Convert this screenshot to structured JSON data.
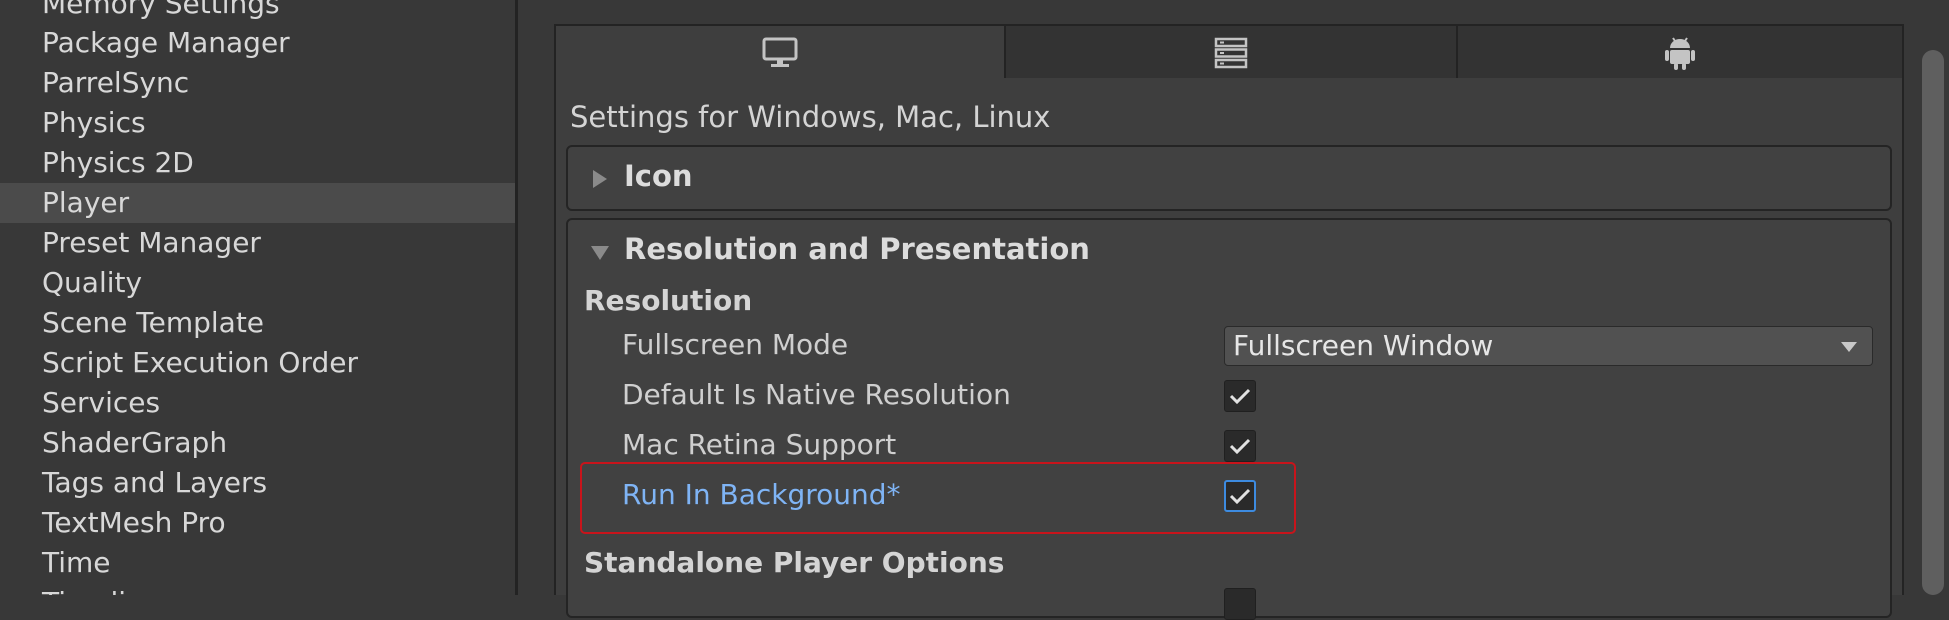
{
  "sidebar": {
    "items": [
      {
        "label": "Memory Settings"
      },
      {
        "label": "Package Manager"
      },
      {
        "label": "ParrelSync"
      },
      {
        "label": "Physics"
      },
      {
        "label": "Physics 2D"
      },
      {
        "label": "Player",
        "selected": true
      },
      {
        "label": "Preset Manager"
      },
      {
        "label": "Quality"
      },
      {
        "label": "Scene Template"
      },
      {
        "label": "Script Execution Order"
      },
      {
        "label": "Services"
      },
      {
        "label": "ShaderGraph"
      },
      {
        "label": "Tags and Layers"
      },
      {
        "label": "TextMesh Pro"
      },
      {
        "label": "Time"
      },
      {
        "label": "Timeline"
      }
    ]
  },
  "platform_tabs": [
    {
      "icon": "monitor-icon",
      "active": true
    },
    {
      "icon": "server-icon",
      "active": false
    },
    {
      "icon": "android-icon",
      "active": false
    }
  ],
  "main": {
    "settings_title": "Settings for Windows, Mac, Linux",
    "icon_section": {
      "label": "Icon"
    },
    "resolution_section": {
      "label": "Resolution and Presentation",
      "resolution_label": "Resolution",
      "fullscreen_mode": {
        "label": "Fullscreen Mode",
        "value": "Fullscreen Window"
      },
      "default_native_resolution": {
        "label": "Default Is Native Resolution",
        "checked": true
      },
      "mac_retina_support": {
        "label": "Mac Retina Support",
        "checked": true
      },
      "run_in_background": {
        "label": "Run In Background*",
        "checked": true
      },
      "standalone_label": "Standalone Player Options"
    }
  },
  "colors": {
    "modified_label": "#7fb4f5",
    "highlight": "#c8141b",
    "focus_border": "#3d8be0"
  }
}
